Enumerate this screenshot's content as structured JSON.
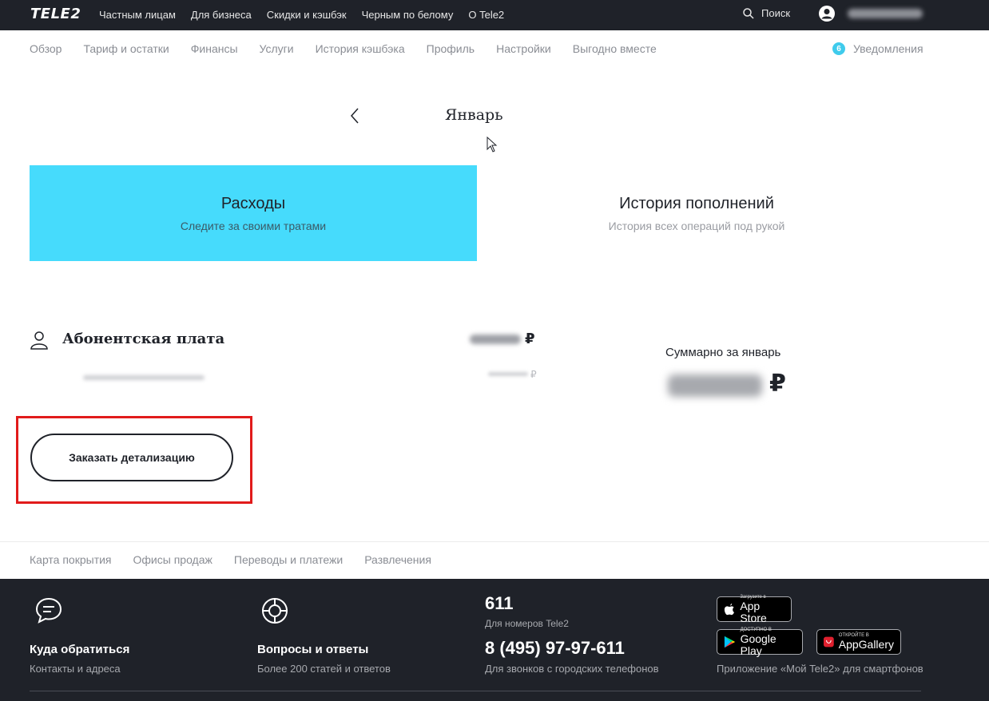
{
  "header": {
    "logo": "TELE2",
    "nav": [
      "Частным лицам",
      "Для бизнеса",
      "Скидки и кэшбэк",
      "Черным по белому",
      "О Tele2"
    ],
    "search_label": "Поиск"
  },
  "subnav": {
    "items": [
      "Обзор",
      "Тариф и остатки",
      "Финансы",
      "Услуги",
      "История кэшбэка",
      "Профиль",
      "Настройки",
      "Выгодно вместе"
    ],
    "notifications_count": "6",
    "notifications_label": "Уведомления"
  },
  "month": {
    "title": "Январь",
    "prev_icon": "chevron-left-icon"
  },
  "tabs": {
    "expenses_title": "Расходы",
    "expenses_sub": "Следите за своими тратами",
    "history_title": "История пополнений",
    "history_sub": "История всех операций под рукой"
  },
  "fee": {
    "title": "Абонентская плата",
    "currency": "₽",
    "sum_label": "Суммарно за январь",
    "sum_currency": "₽"
  },
  "detail_button": "Заказать детализацию",
  "footer_links": [
    "Карта покрытия",
    "Офисы продаж",
    "Переводы и платежи",
    "Развлечения"
  ],
  "footer": {
    "contact_title": "Куда обратиться",
    "contact_sub": "Контакты и адреса",
    "faq_title": "Вопросы и ответы",
    "faq_sub": "Более 200 статей и ответов",
    "short_number": "611",
    "short_number_sub": "Для номеров Tele2",
    "long_number": "8 (495) 97-97-611",
    "long_number_sub": "Для звонков с городских телефонов",
    "app_store_small": "Загрузите в",
    "app_store": "App Store",
    "google_play_small": "ДОСТУПНО В",
    "google_play": "Google Play",
    "app_gallery_small": "ОТКРОЙТЕ В",
    "app_gallery": "AppGallery",
    "apps_caption": "Приложение «Мой Tele2» для смартфонов"
  },
  "colors": {
    "dark": "#1f2229",
    "accent": "#46dbfc",
    "highlight": "#e11b1b"
  }
}
